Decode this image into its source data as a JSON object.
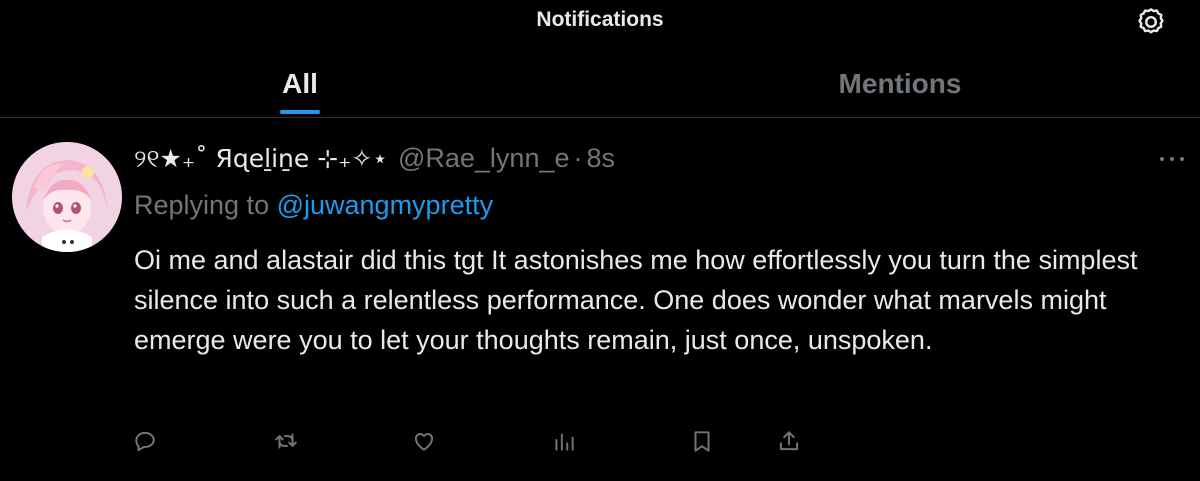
{
  "header": {
    "title": "Notifications",
    "settings_icon": "gear-icon"
  },
  "tabs": [
    {
      "label": "All",
      "selected": true
    },
    {
      "label": "Mentions",
      "selected": false
    }
  ],
  "post": {
    "display_name": "୨୧★₊˚ Яɋeḻiṉe ⊹₊✧⋆",
    "handle": "@Rae_lynn_e",
    "separator": "·",
    "time": "8s",
    "replying_prefix": "Replying to ",
    "replying_to": "@juwangmypretty",
    "text": "Oi me and alastair did this tgt It astonishes me how effortlessly you turn the simplest silence into such a relentless performance. One does wonder what marvels might emerge were you to let your thoughts remain, just once, unspoken."
  },
  "actions": [
    "reply-icon",
    "retweet-icon",
    "like-icon",
    "views-icon",
    "bookmark-icon",
    "share-icon"
  ],
  "colors": {
    "background": "#000000",
    "text": "#e7e9ea",
    "muted": "#71767b",
    "accent": "#1d9bf0",
    "divider": "#2f3336"
  }
}
